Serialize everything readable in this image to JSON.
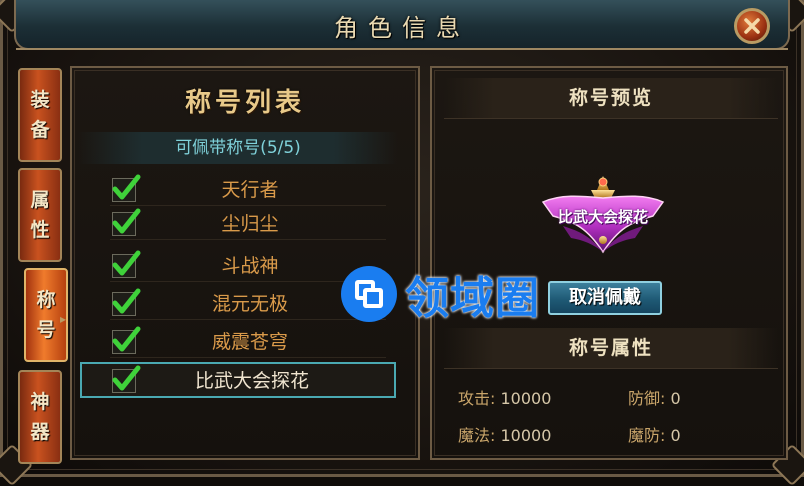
{
  "window": {
    "title": "角色信息",
    "close_icon": "close-icon"
  },
  "side_tabs": [
    {
      "label": "装备",
      "active": false
    },
    {
      "label": "属性",
      "active": false
    },
    {
      "label": "称号",
      "active": true
    },
    {
      "label": "神器",
      "active": false
    }
  ],
  "left_panel": {
    "title": "称号列表",
    "subtitle": "可佩带称号(5/5)",
    "titles": [
      {
        "name": "天行者",
        "checked": true,
        "selected": false
      },
      {
        "name": "尘归尘",
        "checked": true,
        "selected": false
      },
      {
        "name": "斗战神",
        "checked": true,
        "selected": false
      },
      {
        "name": "混元无极",
        "checked": true,
        "selected": false
      },
      {
        "name": "威震苍穹",
        "checked": true,
        "selected": false
      },
      {
        "name": "比武大会探花",
        "checked": true,
        "selected": true
      }
    ]
  },
  "right_panel": {
    "preview_title": "称号预览",
    "badge_text": "比武大会探花",
    "unequip_label": "取消佩戴",
    "attributes_title": "称号属性",
    "attributes": [
      {
        "label": "攻击:",
        "value": "10000"
      },
      {
        "label": "防御:",
        "value": "0"
      },
      {
        "label": "魔法:",
        "value": "10000"
      },
      {
        "label": "魔防:",
        "value": "0"
      }
    ]
  },
  "watermark": {
    "text": "领域圈"
  },
  "colors": {
    "accent_orange": "#d99a4a",
    "cyan_text": "#7fd1d9",
    "select_border": "#4aa9b2",
    "button_blue": "#1f5a75"
  }
}
